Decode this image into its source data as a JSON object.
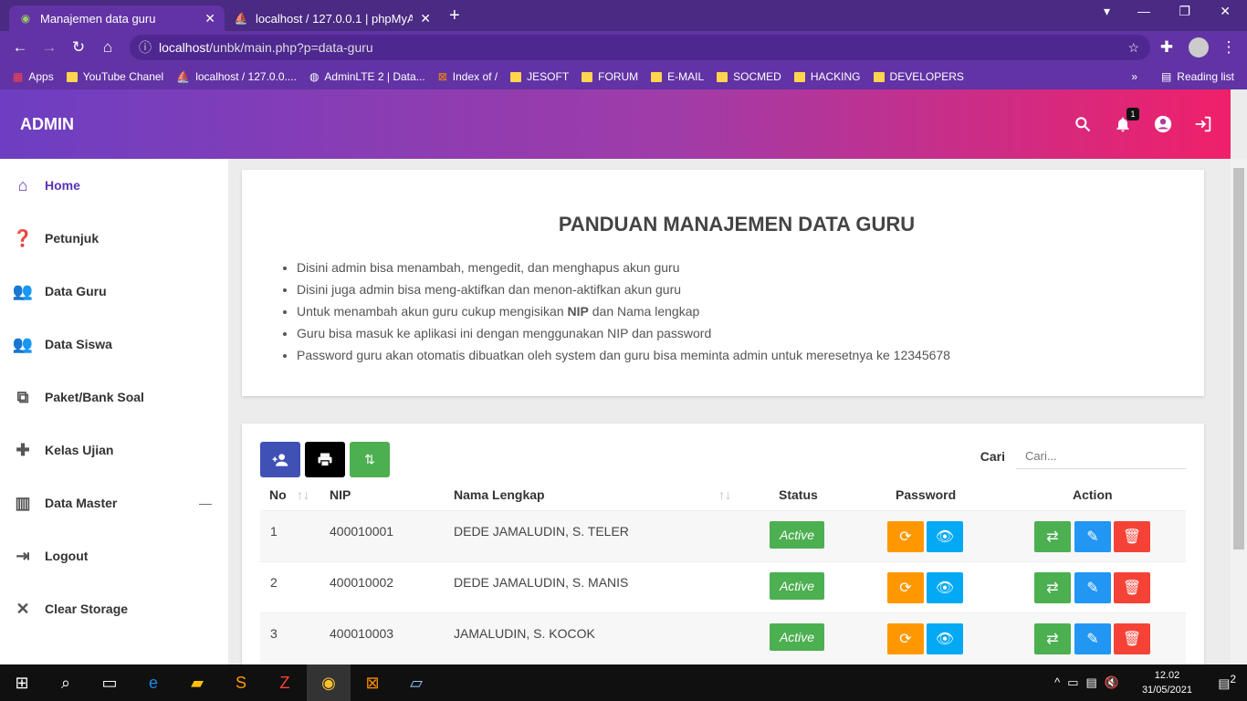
{
  "browser": {
    "tabs": [
      {
        "title": "Manajemen data guru"
      },
      {
        "title": "localhost / 127.0.0.1 | phpMyAdmin"
      }
    ],
    "url_host": "localhost",
    "url_path": "/unbk/main.php?p=data-guru",
    "bookmarks": [
      "Apps",
      "YouTube Chanel",
      "localhost / 127.0.0....",
      "AdminLTE 2 | Data...",
      "Index of /",
      "JESOFT",
      "FORUM",
      "E-MAIL",
      "SOCMED",
      "HACKING",
      "DEVELOPERS"
    ],
    "reading_list": "Reading list"
  },
  "header": {
    "brand": "ADMIN",
    "notif_count": "1"
  },
  "sidebar": {
    "items": [
      {
        "label": "Home",
        "icon": "home-icon"
      },
      {
        "label": "Petunjuk",
        "icon": "help-icon"
      },
      {
        "label": "Data Guru",
        "icon": "people-icon"
      },
      {
        "label": "Data Siswa",
        "icon": "people-icon"
      },
      {
        "label": "Paket/Bank Soal",
        "icon": "filter-2-icon"
      },
      {
        "label": "Kelas Ujian",
        "icon": "class-icon"
      },
      {
        "label": "Data Master",
        "icon": "map-icon"
      },
      {
        "label": "Logout",
        "icon": "logout-icon"
      },
      {
        "label": "Clear Storage",
        "icon": "close-icon"
      }
    ]
  },
  "panduan": {
    "title": "PANDUAN MANAJEMEN DATA GURU",
    "items": [
      "Disini admin bisa menambah, mengedit, dan menghapus akun guru",
      "Disini juga admin bisa meng-aktifkan dan menon-aktifkan akun guru",
      "Guru bisa masuk ke aplikasi ini dengan menggunakan NIP dan password",
      "Password guru akan otomatis dibuatkan oleh system dan guru bisa meminta admin untuk meresetnya ke 12345678"
    ],
    "nip_item": {
      "before": "Untuk menambah akun guru cukup mengisikan ",
      "bold": "NIP",
      "after": " dan Nama lengkap"
    }
  },
  "table": {
    "search_label": "Cari",
    "search_placeholder": "Cari...",
    "headers": {
      "no": "No",
      "nip": "NIP",
      "nama": "Nama Lengkap",
      "status": "Status",
      "password": "Password",
      "action": "Action"
    },
    "rows": [
      {
        "no": "1",
        "nip": "400010001",
        "nama": "DEDE JAMALUDIN, S. TELER",
        "status": "Active"
      },
      {
        "no": "2",
        "nip": "400010002",
        "nama": "DEDE JAMALUDIN, S. MANIS",
        "status": "Active"
      },
      {
        "no": "3",
        "nip": "400010003",
        "nama": "JAMALUDIN, S. KOCOK",
        "status": "Active"
      }
    ]
  },
  "taskbar": {
    "time": "12.02",
    "date": "31/05/2021",
    "notif": "2"
  }
}
